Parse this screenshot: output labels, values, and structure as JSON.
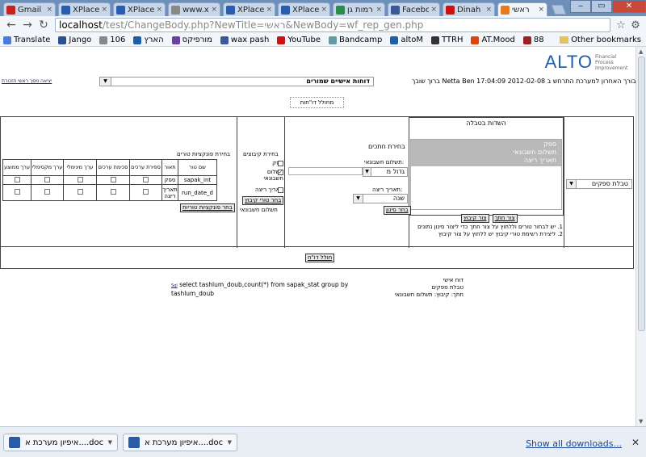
{
  "browser": {
    "tabs": [
      {
        "label": "Gmail",
        "color": "#c5221f"
      },
      {
        "label": "XPlace",
        "color": "#2a5db0"
      },
      {
        "label": "XPlace",
        "color": "#2a5db0"
      },
      {
        "label": "www.x",
        "color": "#888888"
      },
      {
        "label": "XPlace",
        "color": "#2a5db0"
      },
      {
        "label": "XPlace",
        "color": "#2a5db0"
      },
      {
        "label": "רמות גן",
        "color": "#2a8c4a"
      },
      {
        "label": "Facebo",
        "color": "#3b5998"
      },
      {
        "label": "Dinah",
        "color": "#cc1111"
      },
      {
        "label": "ראשי",
        "color": "#e87a1e"
      }
    ],
    "window_buttons": {
      "minimize": "‒",
      "maximize": "▭",
      "close": "✕"
    },
    "url_host": "localhost",
    "url_path": "/test/ChangeBody.php?NewTitle=ראשי&NewBody=wf_rep_gen.php",
    "bookmarks": [
      {
        "label": "Translate",
        "color": "#4a7be0"
      },
      {
        "label": "Jango",
        "color": "#2a4f95"
      },
      {
        "label": "106",
        "color": "#888888"
      },
      {
        "label": "הארץ",
        "color": "#1f5fa6"
      },
      {
        "label": "מורפיקס",
        "color": "#6d3fa0"
      },
      {
        "label": "wax pash",
        "color": "#3b5998"
      },
      {
        "label": "YouTube",
        "color": "#cc1111"
      },
      {
        "label": "Bandcamp",
        "color": "#629aa9"
      },
      {
        "label": "altoM",
        "color": "#1f5fa6"
      },
      {
        "label": "TTRH",
        "color": "#333333"
      },
      {
        "label": "AT.Mood",
        "color": "#dd4411"
      },
      {
        "label": "88",
        "color": "#992222"
      }
    ],
    "other_bookmarks": "Other bookmarks"
  },
  "app": {
    "logo_word": "ALTO",
    "logo_tagline": "Financial Process Improvement",
    "welcome": "ברוך שובך Netta Ben  חיבורך האחרון למערכת התרחש ב 2012-02-08 17:04:09",
    "report_select": "דוחות אישיים שמורים",
    "top_links": "יציאה  מסך ראשי  תזכורת",
    "generate_top": "מחולל דו\"חות"
  },
  "tables": {
    "type_select": "טבלת ספקים",
    "fields_title": "השדות בטבלה",
    "fields": [
      "ספק",
      "תשלום חשבונאי",
      "תאריך ריצה"
    ],
    "add_filter_btn": "צור חתך",
    "add_group_btn": "צור קיבוץ",
    "notes": [
      "1. יש לבחור טורים וללחוץ על צור חתך כדי ליצור סינון נתונים",
      "2. ליצירת רשימת טורי קיבוץ יש ללחוץ על צור קיבוץ"
    ]
  },
  "filters": {
    "title": "בחירת חתכים",
    "payment_label": "תשלום חשבונאי:",
    "payment_op": "גדול מ",
    "date_label": "תאריך ריצה:",
    "date_op": "שנה",
    "filter_btn": "בחר סינון"
  },
  "grouping": {
    "title": "בחירת קיבוצים",
    "items": [
      {
        "label": "ספק",
        "checked": false
      },
      {
        "label": "תשלום חשבונאי",
        "checked": true
      },
      {
        "label": "תאריך ריצה",
        "checked": false
      }
    ],
    "select_btn": "בחר טורי קיבוץ",
    "footer": "תשלום חשבונאי"
  },
  "functions": {
    "title": "בחירת פונקציות טורים",
    "headers": [
      "שם טור",
      "תאור",
      "ספירת ערכים",
      "סכימת ערכים",
      "ערך מינימלי",
      "ערך מקסימלי",
      "ערך ממוצע"
    ],
    "rows": [
      {
        "name": "sapak_int",
        "desc": "ספק"
      },
      {
        "name": "run_date_d",
        "desc": "תאריך ריצה"
      }
    ],
    "select_btn": "בחר פונקציות טוריות"
  },
  "bottom": {
    "generate_btn": "חולל דו\"ח",
    "summary": [
      "דוח אישי",
      "טבלת ספקים",
      "חתך: קיבוץ: תשלום חשבונאי"
    ],
    "sql_prefix": "Sql",
    "sql": "select tashlum_doub,count(*) from sapak_stat group by tashlum_doub"
  },
  "downloads": {
    "items": [
      "איפיון מערכת א....doc",
      "איפיון מערכת א....doc"
    ],
    "show_all": "Show all downloads..."
  }
}
